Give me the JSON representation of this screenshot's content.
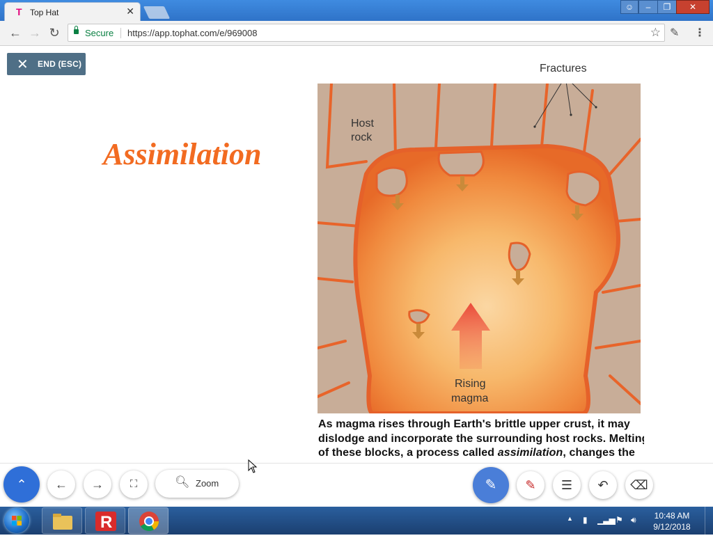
{
  "browser": {
    "tab_title": "Top Hat",
    "tab_close": "✕",
    "secure_label": "Secure",
    "url": "https://app.tophat.com/e/969008"
  },
  "page": {
    "end_button_label": "END (ESC)",
    "slide_title": "Assimilation",
    "figure": {
      "labels": {
        "fractures": "Fractures",
        "host_rock_line1": "Host",
        "host_rock_line2": "rock",
        "rising_magma_line1": "Rising",
        "rising_magma_line2": "magma"
      }
    },
    "caption": {
      "line1": "As magma rises through Earth's brittle upper crust, it may",
      "line2": "dislodge and incorporate the surrounding host rocks. Melting",
      "line3_before": "of these blocks, a process called ",
      "line3_em": "assimilation",
      "line3_after": ", changes the"
    }
  },
  "bottom_toolbar": {
    "zoom_label": "Zoom"
  },
  "taskbar": {
    "time": "10:48 AM",
    "date": "9/12/2018"
  },
  "colors": {
    "title_orange": "#f26b21",
    "primary_blue": "#2f6fd8",
    "end_button_bg": "#4f6f86",
    "secure_green": "#0b8043"
  }
}
